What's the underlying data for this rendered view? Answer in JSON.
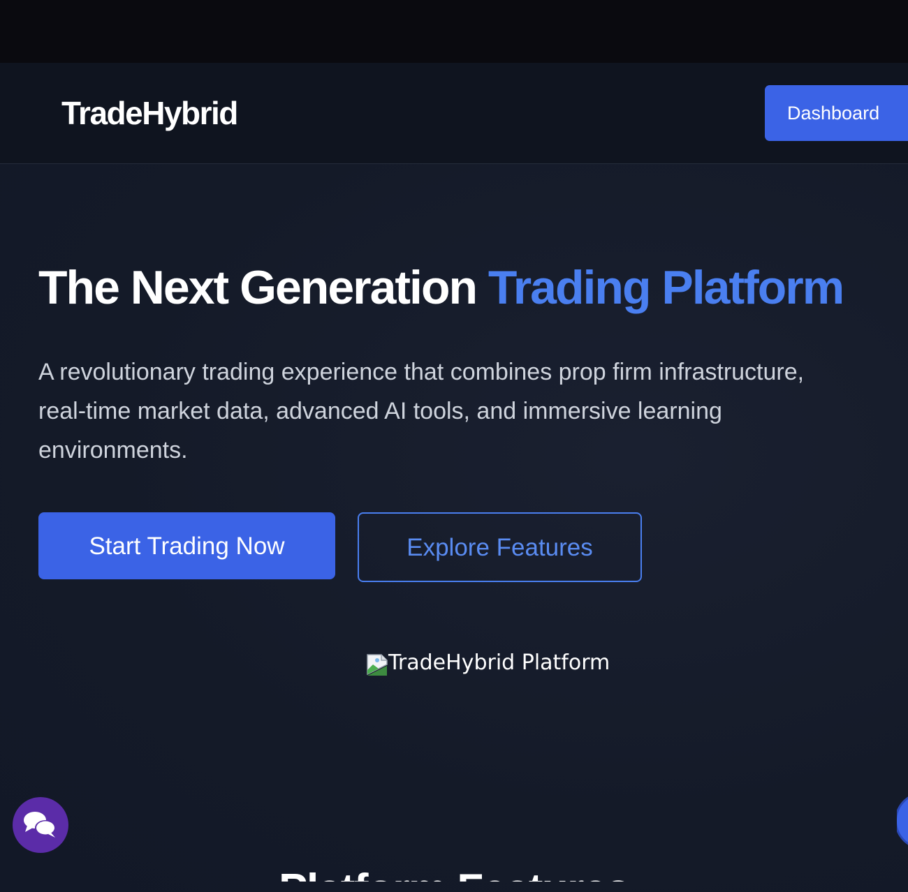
{
  "header": {
    "brand": "TradeHybrid",
    "dashboard_label": "Dashboard"
  },
  "hero": {
    "title_main": "The Next Generation ",
    "title_accent": "Trading Platform",
    "description": "A revolutionary trading experience that combines prop firm infrastructure, real-time market data, advanced AI tools, and immersive learning environments.",
    "primary_cta": "Start Trading Now",
    "secondary_cta": "Explore Features",
    "image_alt": "TradeHybrid Platform"
  },
  "features": {
    "heading": "Platform Features"
  },
  "widgets": {
    "chat_icon": "chat-bubbles-icon",
    "edge_icon": "floating-action-icon"
  },
  "colors": {
    "accent": "#4a7ff0",
    "button_primary": "#3b63e6",
    "chat_button": "#5b2ca8",
    "background": "#131a28"
  }
}
